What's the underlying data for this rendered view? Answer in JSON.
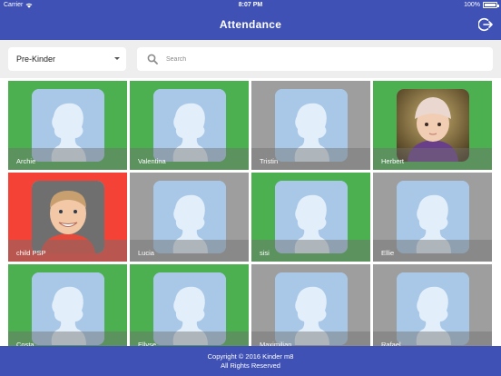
{
  "status_bar": {
    "carrier": "Carrier",
    "time": "8:07 PM",
    "battery": "100%"
  },
  "header": {
    "title": "Attendance",
    "logout_icon": "logout-icon"
  },
  "filters": {
    "class_select": {
      "value": "Pre-Kinder"
    },
    "search": {
      "placeholder": "Search",
      "value": "",
      "icon": "search-icon"
    }
  },
  "colors": {
    "header": "#3f51b5",
    "present": "#4caf50",
    "absent": "#9e9e9e",
    "alert": "#f44336",
    "placeholder_avatar": "#a9c8e8"
  },
  "students": [
    {
      "name": "Archie",
      "status": "present",
      "photo": "placeholder"
    },
    {
      "name": "Valentina",
      "status": "present",
      "photo": "placeholder"
    },
    {
      "name": "Tristin",
      "status": "absent",
      "photo": "placeholder"
    },
    {
      "name": "Herbert",
      "status": "present",
      "photo": "girl-beanie"
    },
    {
      "name": "child PSP",
      "status": "alert",
      "photo": "boy-smiling"
    },
    {
      "name": "Lucia",
      "status": "absent",
      "photo": "placeholder"
    },
    {
      "name": "sisi",
      "status": "present",
      "photo": "placeholder"
    },
    {
      "name": "Ellie",
      "status": "absent",
      "photo": "placeholder"
    },
    {
      "name": "Costa",
      "status": "present",
      "photo": "placeholder"
    },
    {
      "name": "Ellyse",
      "status": "present",
      "photo": "placeholder"
    },
    {
      "name": "Maximilian",
      "status": "absent",
      "photo": "placeholder"
    },
    {
      "name": "Rafael",
      "status": "absent",
      "photo": "placeholder"
    }
  ],
  "footer": {
    "line1": "Copyright © 2016 Kinder m8",
    "line2": "All Rights Reserved"
  }
}
